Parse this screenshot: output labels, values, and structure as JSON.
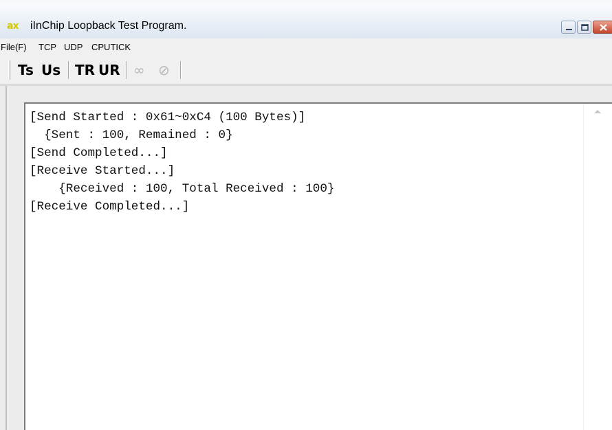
{
  "window": {
    "icon_text": "ax",
    "title": "iInChip Loopback Test Program.",
    "controls": [
      "minimize",
      "maximize",
      "close"
    ]
  },
  "menubar": {
    "items": [
      "File(F)",
      "TCP",
      "UDP",
      "CPUTICK"
    ]
  },
  "toolbar": {
    "buttons": [
      {
        "label": "Ts",
        "name": "tcp-send",
        "enabled": true
      },
      {
        "label": "Us",
        "name": "udp-send",
        "enabled": true
      },
      {
        "label": "TR",
        "name": "tcp-receive",
        "enabled": true
      },
      {
        "label": "UR",
        "name": "udp-receive",
        "enabled": true
      },
      {
        "label": "∞",
        "name": "loop",
        "enabled": false
      },
      {
        "label": "⊘",
        "name": "stop",
        "enabled": false
      }
    ]
  },
  "log": {
    "lines": [
      "[Send Started : 0x61~0xC4 (100 Bytes)]",
      "  {Sent : 100, Remained : 0}",
      "[Send Completed...]",
      "[Receive Started...]",
      "    {Received : 100, Total Received : 100}",
      "[Receive Completed...]"
    ]
  },
  "colors": {
    "icon": "#d4c800",
    "close_button": "#c5462e"
  }
}
